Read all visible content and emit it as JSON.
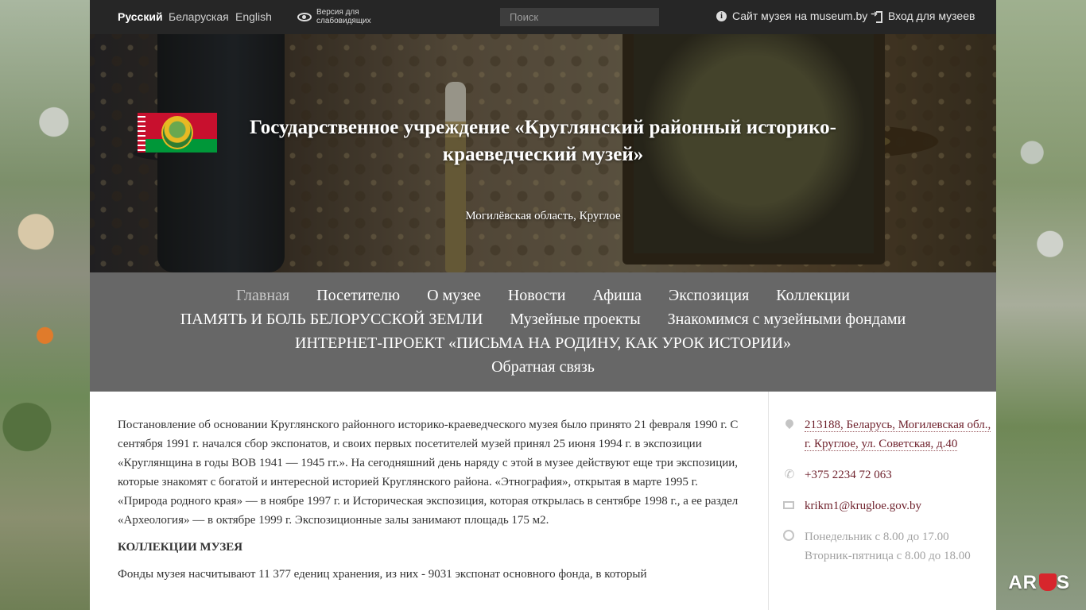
{
  "topbar": {
    "languages": [
      {
        "label": "Русский",
        "active": true
      },
      {
        "label": "Беларуская",
        "active": false
      },
      {
        "label": "English",
        "active": false
      }
    ],
    "low_vision_label": "Версия для слабовидящих",
    "search_placeholder": "Поиск",
    "site_link": "Сайт музея на museum.by",
    "login_link": "Вход для музеев"
  },
  "hero": {
    "title": "Государственное учреждение «Круглянский районный историко-краеведческий музей»",
    "subtitle": "Могилёвская область, Круглое"
  },
  "nav": {
    "rows": [
      [
        "Главная",
        "Посетителю",
        "О музее",
        "Новости",
        "Афиша",
        "Экспозиция",
        "Коллекции"
      ],
      [
        "ПАМЯТЬ И БОЛЬ БЕЛОРУССКОЙ ЗЕМЛИ",
        "Музейные проекты",
        "Знакомимся с музейными фондами"
      ],
      [
        "ИНТЕРНЕТ-ПРОЕКТ «ПИСЬМА НА РОДИНУ, КАК УРОК ИСТОРИИ»"
      ],
      [
        "Обратная связь"
      ]
    ],
    "current": "Главная"
  },
  "main": {
    "paragraph1": "Постановление об основании Круглянского районного историко-краеведческого музея было принято 21 февраля 1990 г. С сентября 1991 г. начался сбор экспонатов, и своих первых посетителей музей принял 25 июня 1994 г. в экспозиции «Круглянщина в годы ВОВ 1941 — 1945 гг.». На сегодняшний день наряду с этой в музее действуют еще три экспозиции, которые знакомят с богатой и интересной историей Круглянского района. «Этнография», открытая в марте 1995 г. «Природа родного края» — в ноябре 1997 г. и Историческая экспозиция, которая открылась в сентябре 1998 г., а ее раздел «Археология» — в октябре 1999 г. Экспозиционные залы занимают площадь 175 м2.",
    "heading": "КОЛЛЕКЦИИ МУЗЕЯ",
    "paragraph2": "Фонды музея насчитывают 11 377 едениц хранения, из них - 9031 экспонат основного фонда, в который"
  },
  "sidebar": {
    "address": "213188, Беларусь, Могилевская обл., г. Круглое, ул. Советская, д.40",
    "phone": "+375 2234 72 063",
    "email": "krikm1@krugloe.gov.by",
    "hours": "Понедельник с 8.00 до 17.00 Вторник-пятница с 8.00 до 18.00"
  },
  "colors": {
    "topbar": "#262626",
    "nav": "#676767",
    "link": "#6d1f2a",
    "flag_red": "#c8102e",
    "flag_green": "#009739"
  },
  "icons": [
    "eye-icon",
    "info-icon",
    "login-icon",
    "map-pin-icon",
    "phone-icon",
    "mail-icon",
    "clock-icon"
  ]
}
